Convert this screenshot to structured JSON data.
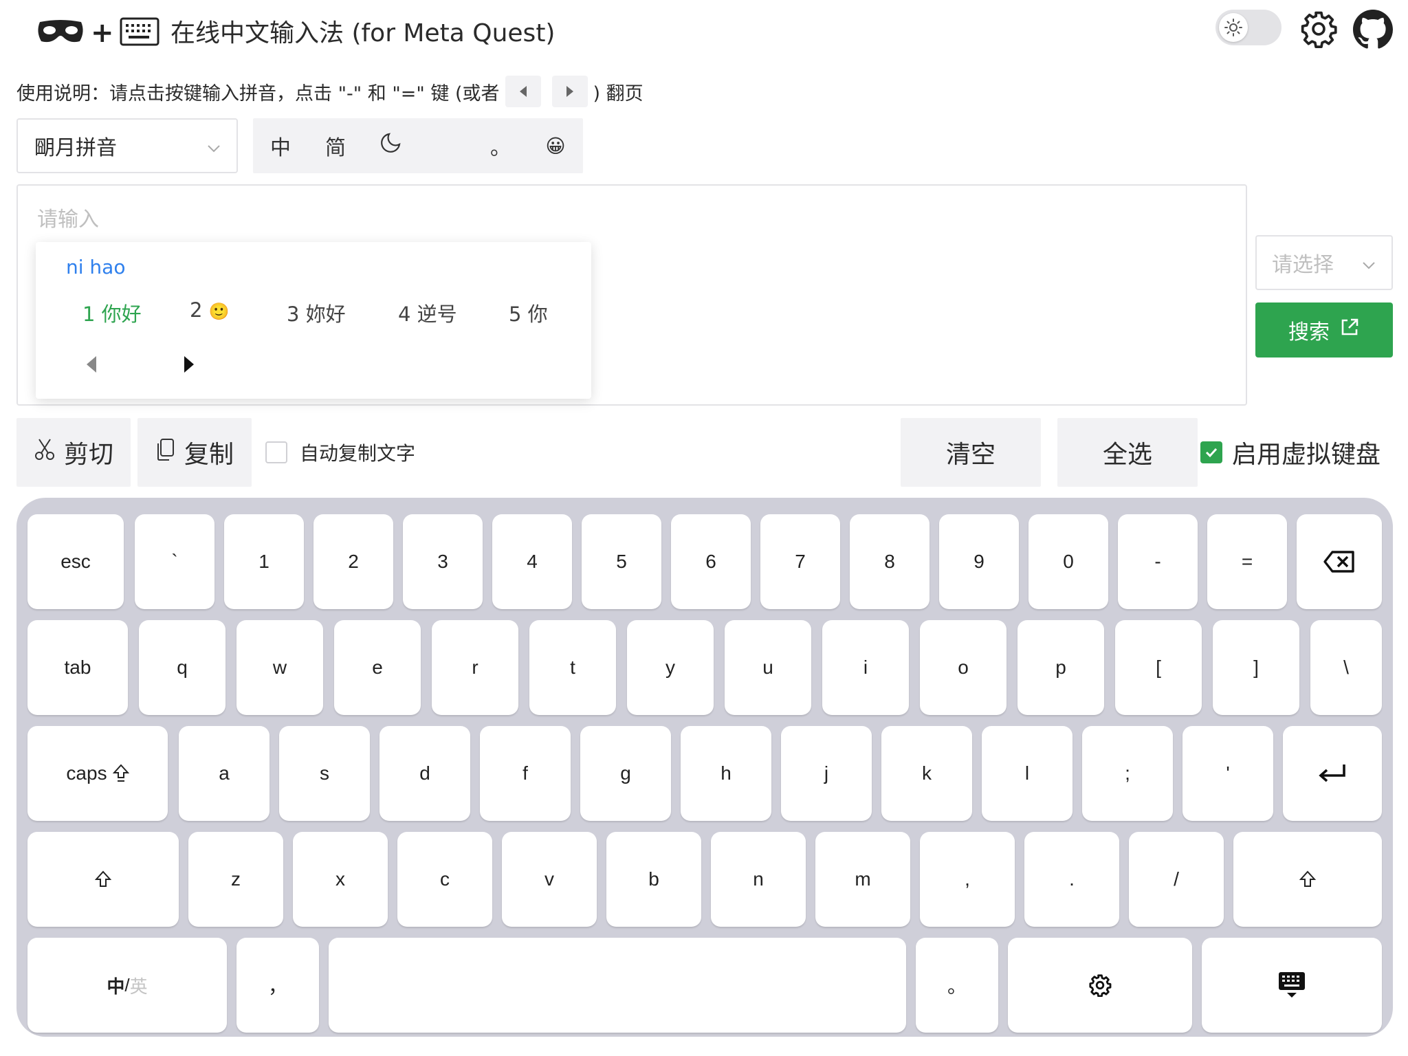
{
  "header": {
    "logo_plus": "+",
    "title": "在线中文输入法 (for Meta Quest)",
    "theme_toggle": "light",
    "icons": [
      "vr-headset-icon",
      "keyboard-icon",
      "sun-icon",
      "gear-icon",
      "github-icon"
    ]
  },
  "instructions": {
    "prefix": "使用说明：请点击按键输入拼音，点击 \"-\" 和 \"=\" 键 (或者",
    "suffix": ") 翻页"
  },
  "ime": {
    "selected": "朙月拼音",
    "toolbar": {
      "chinese": "中",
      "simplified": "简",
      "punct": "。",
      "emoji": "😀"
    }
  },
  "text_input": {
    "placeholder": "请输入",
    "value": ""
  },
  "candidates": {
    "pinyin": "ni hao",
    "items": [
      {
        "index": "1",
        "text": "你好"
      },
      {
        "index": "2",
        "text": "🙂"
      },
      {
        "index": "3",
        "text": "妳好"
      },
      {
        "index": "4",
        "text": "逆号"
      },
      {
        "index": "5",
        "text": "你"
      }
    ]
  },
  "search": {
    "engine_placeholder": "请选择",
    "button_label": "搜索"
  },
  "actions": {
    "cut": "剪切",
    "copy": "复制",
    "auto_copy_label": "自动复制文字",
    "auto_copy_checked": false,
    "clear": "清空",
    "select_all": "全选",
    "virtual_keyboard_label": "启用虚拟键盘",
    "virtual_keyboard_checked": true
  },
  "colors": {
    "accent_green": "#2ea44f",
    "pinyin_blue": "#2f80ed",
    "keyboard_bg": "#cfcfd9"
  },
  "keyboard": {
    "row1": [
      "esc",
      "`",
      "1",
      "2",
      "3",
      "4",
      "5",
      "6",
      "7",
      "8",
      "9",
      "0",
      "-",
      "="
    ],
    "row2": [
      "tab",
      "q",
      "w",
      "e",
      "r",
      "t",
      "y",
      "u",
      "i",
      "o",
      "p",
      "[",
      "]",
      "\\"
    ],
    "row3": [
      "caps",
      "a",
      "s",
      "d",
      "f",
      "g",
      "h",
      "j",
      "k",
      "l",
      ";",
      "'"
    ],
    "row4": [
      "z",
      "x",
      "c",
      "v",
      "b",
      "n",
      "m",
      ",",
      ".",
      "/"
    ],
    "row5": {
      "lang_main": "中",
      "lang_sep": "/",
      "lang_alt": "英",
      "comma": "，",
      "period": "。"
    }
  }
}
